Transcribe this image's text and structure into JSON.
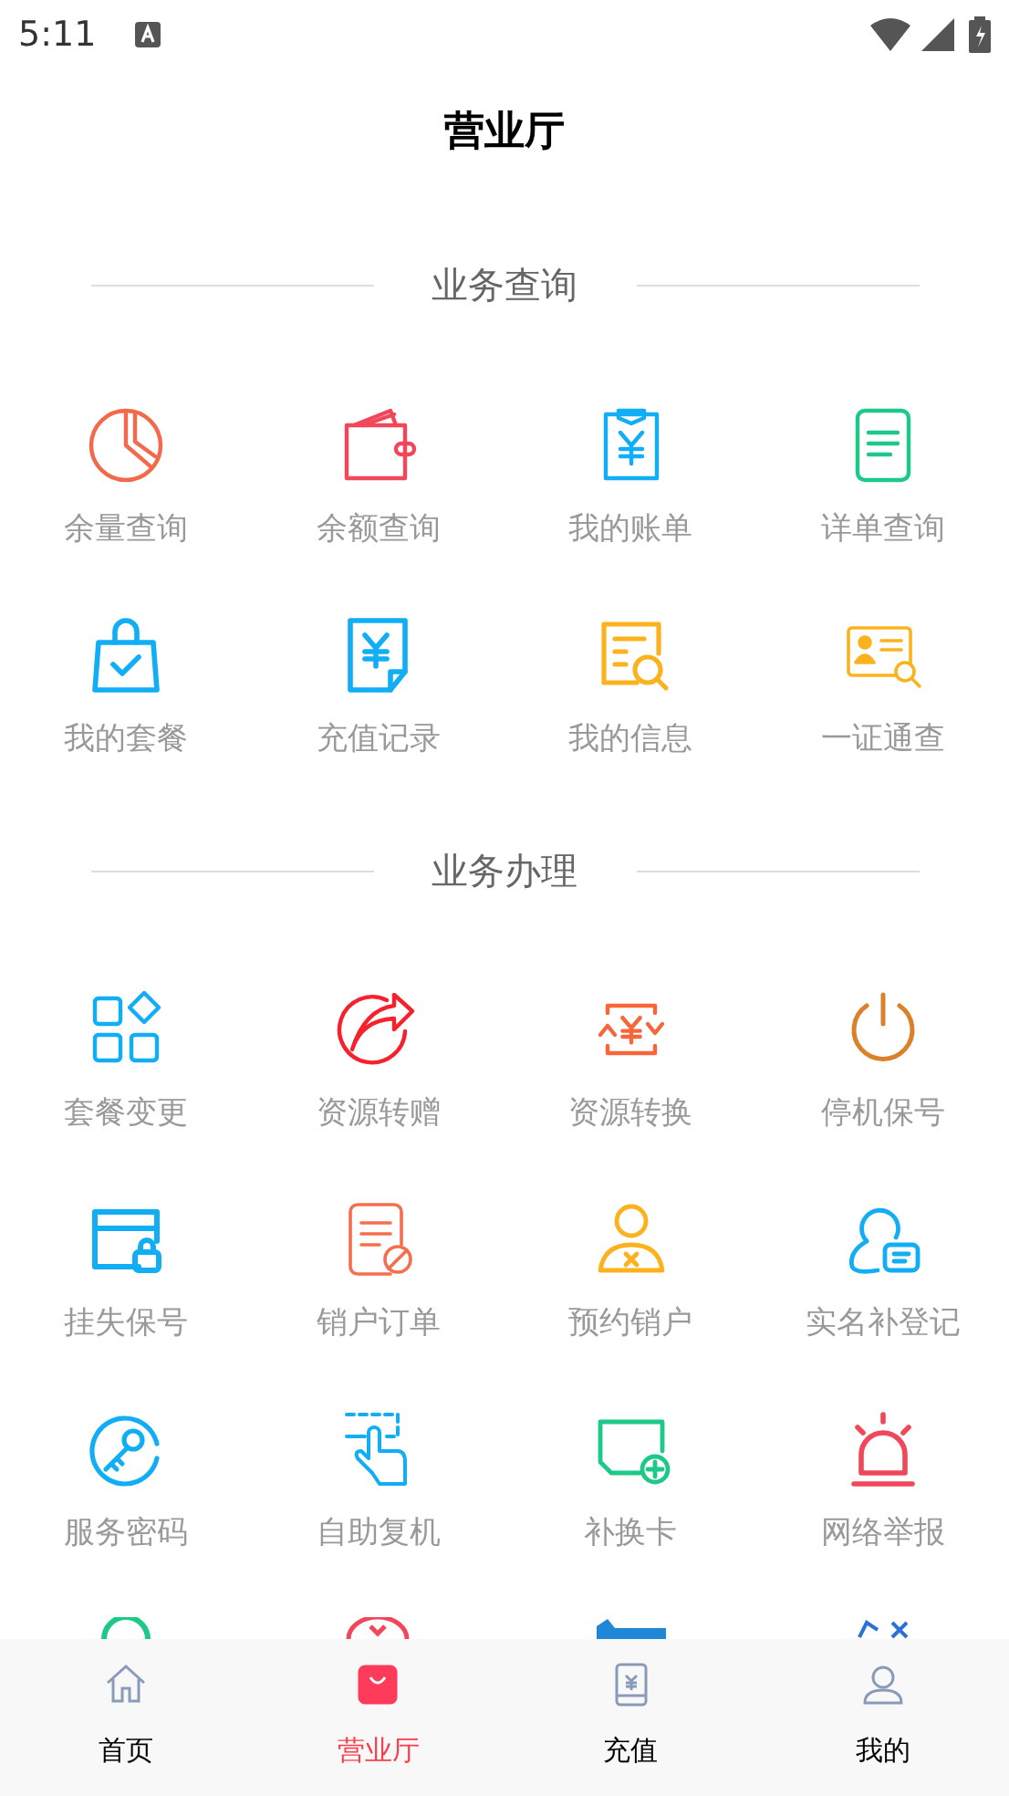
{
  "status_bar": {
    "time": "5:11"
  },
  "title": "营业厅",
  "sections": [
    {
      "title": "业务查询",
      "items": [
        {
          "label": "余量查询"
        },
        {
          "label": "余额查询"
        },
        {
          "label": "我的账单"
        },
        {
          "label": "详单查询"
        },
        {
          "label": "我的套餐"
        },
        {
          "label": "充值记录"
        },
        {
          "label": "我的信息"
        },
        {
          "label": "一证通查"
        }
      ]
    },
    {
      "title": "业务办理",
      "items": [
        {
          "label": "套餐变更"
        },
        {
          "label": "资源转赠"
        },
        {
          "label": "资源转换"
        },
        {
          "label": "停机保号"
        },
        {
          "label": "挂失保号"
        },
        {
          "label": "销户订单"
        },
        {
          "label": "预约销户"
        },
        {
          "label": "实名补登记"
        },
        {
          "label": "服务密码"
        },
        {
          "label": "自助复机"
        },
        {
          "label": "补换卡"
        },
        {
          "label": "网络举报"
        }
      ]
    }
  ],
  "tab_bar": [
    {
      "label": "首页",
      "selected": false
    },
    {
      "label": "营业厅",
      "selected": true
    },
    {
      "label": "充值",
      "selected": false
    },
    {
      "label": "我的",
      "selected": false
    }
  ]
}
